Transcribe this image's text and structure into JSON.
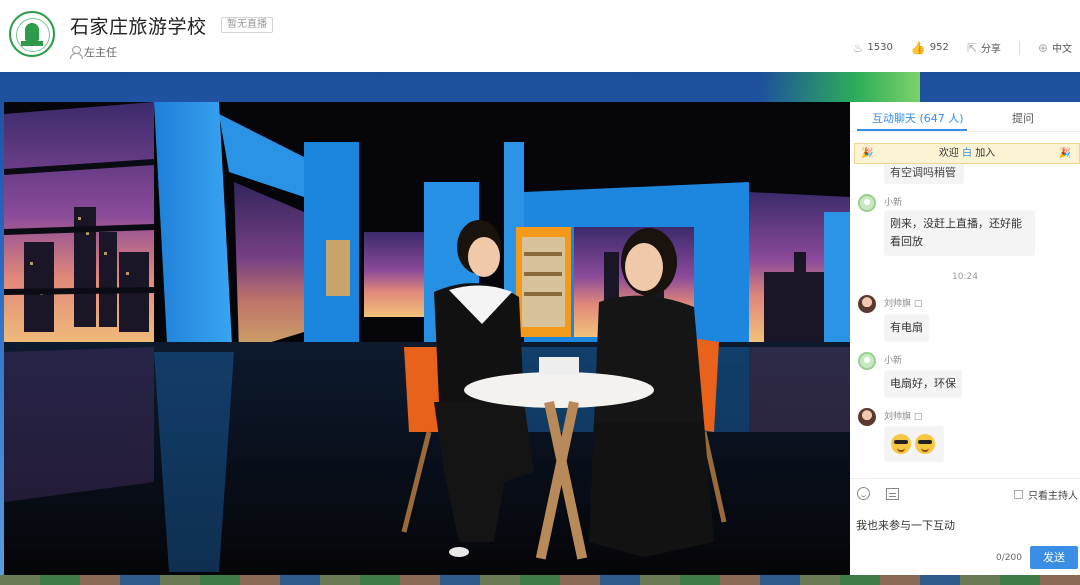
{
  "header": {
    "school_name": "石家庄旅游学校",
    "live_status": "暂无直播",
    "host_name": "左主任",
    "likes": "1530",
    "thumbs": "952",
    "share_label": "分享",
    "language_label": "中文"
  },
  "chat": {
    "tabs": {
      "interactive": "互动聊天 (647 人)",
      "question": "提问"
    },
    "welcome": {
      "prefix": "欢迎",
      "name": "白",
      "suffix": "加入"
    },
    "messages": [
      {
        "user": "",
        "text": "有空调吗稍管"
      },
      {
        "user": "小新",
        "text": "刚来，没赶上直播，还好能看回放"
      },
      {
        "time": "10:24"
      },
      {
        "user": "刘帅旗",
        "badge": "□",
        "text": "有电扇"
      },
      {
        "user": "小新",
        "text": "电扇好，环保"
      },
      {
        "user": "刘帅旗",
        "badge": "□",
        "text": "emoji-cool-x2"
      }
    ],
    "only_host_label": "只看主持人",
    "input_value": "我也来参与一下互动",
    "counter": "0/200",
    "send_label": "发送"
  },
  "colors": {
    "accent": "#3a8ee6",
    "logo_green": "#2e9b4a",
    "welcome_bg": "#fbf3d3"
  },
  "icons": [
    "school-logo",
    "user-icon",
    "flame-icon",
    "thumbs-up-icon",
    "share-icon",
    "globe-icon",
    "party-icon",
    "emoji-icon",
    "text-icon"
  ]
}
